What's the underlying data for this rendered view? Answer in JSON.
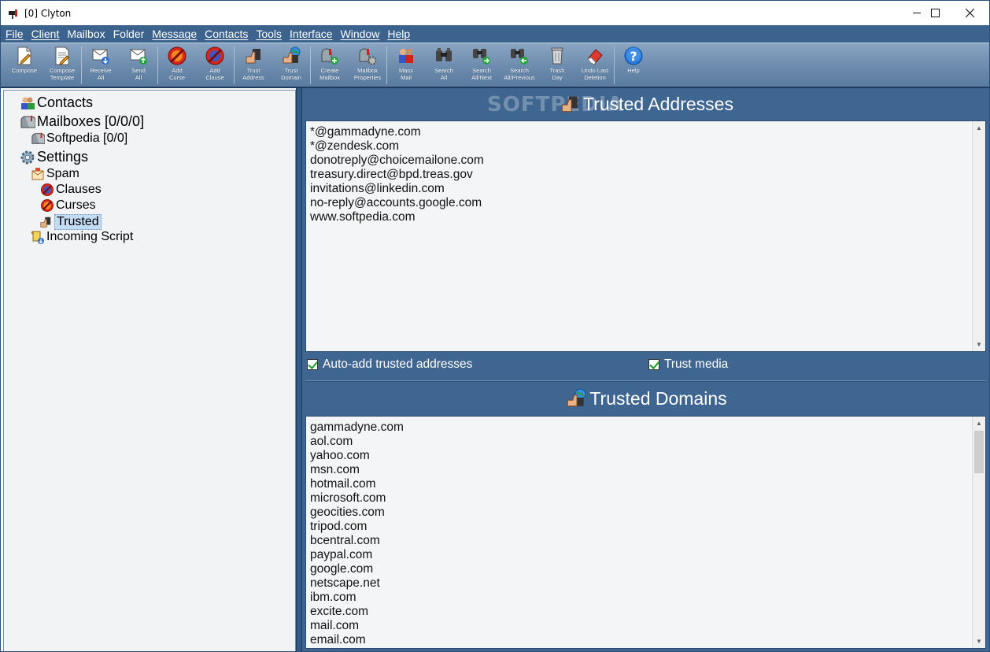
{
  "window": {
    "title": "[0] Clyton",
    "minimize_glyph": "—",
    "maximize_glyph": "☐",
    "close_glyph": "✕"
  },
  "menu": [
    "File",
    "Client",
    "Mailbox",
    "Folder",
    "Message",
    "Contacts",
    "Tools",
    "Interface",
    "Window",
    "Help"
  ],
  "toolbar": [
    {
      "label": "Compose",
      "icon": "compose-icon"
    },
    {
      "label": "Compose\nTemplate",
      "icon": "template-icon"
    },
    {
      "label": "Receive\nAll",
      "icon": "receive-icon"
    },
    {
      "label": "Send\nAll",
      "icon": "send-icon"
    },
    {
      "label": "Add\nCurse",
      "icon": "curse-icon"
    },
    {
      "label": "Add\nClause",
      "icon": "clause-icon"
    },
    {
      "label": "Trust\nAddress",
      "icon": "trust-address-icon"
    },
    {
      "label": "Trust\nDomain",
      "icon": "trust-domain-icon"
    },
    {
      "label": "Create\nMailbox",
      "icon": "create-mailbox-icon"
    },
    {
      "label": "Mailbox\nProperties",
      "icon": "mailbox-properties-icon"
    },
    {
      "label": "Mass\nMail",
      "icon": "mass-mail-icon"
    },
    {
      "label": "Search\nAll",
      "icon": "search-all-icon"
    },
    {
      "label": "Search\nAll/Next",
      "icon": "search-next-icon"
    },
    {
      "label": "Search\nAll/Previous",
      "icon": "search-previous-icon"
    },
    {
      "label": "Trash\nDay",
      "icon": "trash-icon"
    },
    {
      "label": "Undo Last\nDeletion",
      "icon": "eraser-icon"
    },
    {
      "label": "Help",
      "icon": "help-icon"
    }
  ],
  "tree": {
    "contacts": "Contacts",
    "mailboxes": "Mailboxes [0/0/0]",
    "softpedia": "Softpedia [0/0]",
    "settings": "Settings",
    "spam": "Spam",
    "clauses": "Clauses",
    "curses": "Curses",
    "trusted": "Trusted",
    "incoming_script": "Incoming Script"
  },
  "trusted_addresses": {
    "title": "Trusted Addresses",
    "watermark": "SOFTPEDIA",
    "items": [
      "*@gammadyne.com",
      "*@zendesk.com",
      "donotreply@choicemailone.com",
      "treasury.direct@bpd.treas.gov",
      "invitations@linkedin.com",
      "no-reply@accounts.google.com",
      "www.softpedia.com"
    ]
  },
  "options": {
    "auto_add": "Auto-add trusted addresses",
    "trust_media": "Trust media",
    "auto_add_checked": true,
    "trust_media_checked": true
  },
  "trusted_domains": {
    "title": "Trusted Domains",
    "items": [
      "gammadyne.com",
      "aol.com",
      "yahoo.com",
      "msn.com",
      "hotmail.com",
      "microsoft.com",
      "geocities.com",
      "tripod.com",
      "bcentral.com",
      "paypal.com",
      "google.com",
      "netscape.net",
      "ibm.com",
      "excite.com",
      "mail.com",
      "email.com"
    ]
  },
  "colors": {
    "menubar": "#3b638d",
    "panel": "#3f6690",
    "selection": "#c3dcf5"
  }
}
